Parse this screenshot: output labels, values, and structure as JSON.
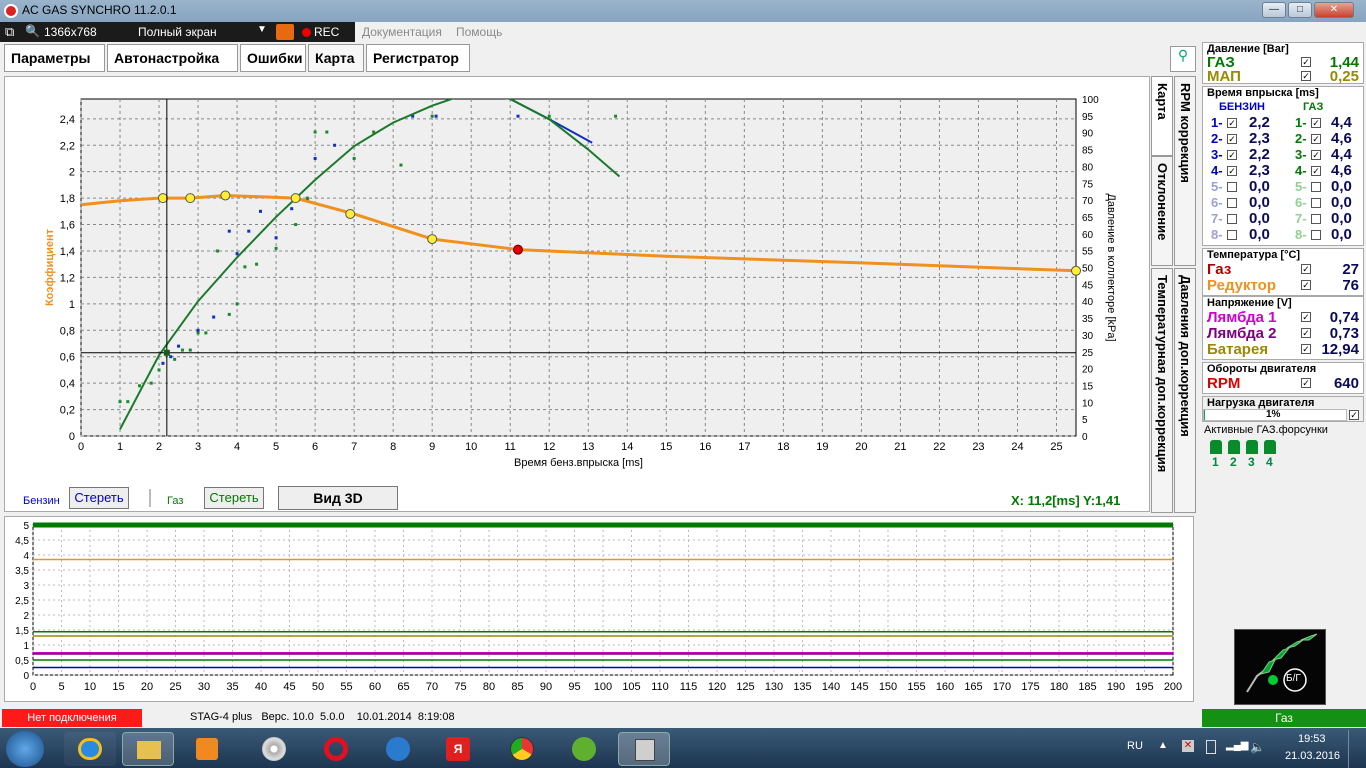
{
  "window": {
    "title": "AC GAS SYNCHRO  11.2.0.1",
    "btn_min": "—",
    "btn_max": "□",
    "btn_close": "✕"
  },
  "toolbar": {
    "resolution": "1366x768",
    "mode": "Полный экран",
    "rec": "REC"
  },
  "menu": {
    "documentation": "Документация",
    "help": "Помощь"
  },
  "tabs": [
    "Параметры",
    "Автонастройка",
    "Ошибки",
    "Карта",
    "Регистратор"
  ],
  "chart": {
    "ylabel_left": "Коэффициент",
    "ylabel_right": "Давление в коллекторе [kPa]",
    "xlabel": "Время бенз.впрыска [ms]"
  },
  "side_tabs": [
    "Карта",
    "RPM коррекция",
    "Отклонение",
    "Давления доп.коррекция",
    "Температурная доп.коррекция"
  ],
  "controls": {
    "benzin_label": "Бензин",
    "gas_label": "Газ",
    "clear1": "Стереть",
    "clear2": "Стереть",
    "view3d": "Вид 3D",
    "xy": "X: 11,2[ms] Y:1,41"
  },
  "pressure": {
    "header": "Давление [Bar]",
    "gas_label": "ГАЗ",
    "gas_value": "1,44",
    "map_label": "МАП",
    "map_value": "0,25"
  },
  "injection": {
    "header": "Время впрыска [ms]",
    "benzin": "БЕНЗИН",
    "gas": "ГАЗ",
    "rows": [
      {
        "n": "1-",
        "b": "2,2",
        "gn": "1-",
        "g": "4,4",
        "on": true
      },
      {
        "n": "2-",
        "b": "2,3",
        "gn": "2-",
        "g": "4,6",
        "on": true
      },
      {
        "n": "3-",
        "b": "2,2",
        "gn": "3-",
        "g": "4,4",
        "on": true
      },
      {
        "n": "4-",
        "b": "2,3",
        "gn": "4-",
        "g": "4,6",
        "on": true
      },
      {
        "n": "5-",
        "b": "0,0",
        "gn": "5-",
        "g": "0,0",
        "on": false
      },
      {
        "n": "6-",
        "b": "0,0",
        "gn": "6-",
        "g": "0,0",
        "on": false
      },
      {
        "n": "7-",
        "b": "0,0",
        "gn": "7-",
        "g": "0,0",
        "on": false
      },
      {
        "n": "8-",
        "b": "0,0",
        "gn": "8-",
        "g": "0,0",
        "on": false
      }
    ]
  },
  "temperature": {
    "header": "Температура [°C]",
    "gas_label": "Газ",
    "gas_value": "27",
    "red_label": "Редуктор",
    "red_value": "76"
  },
  "voltage": {
    "header": "Напряжение [V]",
    "l1_label": "Лямбда 1",
    "l1_value": "0,74",
    "l2_label": "Лямбда 2",
    "l2_value": "0,73",
    "bat_label": "Батарея",
    "bat_value": "12,94"
  },
  "rpm": {
    "header": "Обороты двигателя",
    "label": "RPM",
    "value": "640"
  },
  "load": {
    "header": "Нагрузка двигателя",
    "value": "1%"
  },
  "injectors": {
    "header": "Активные ГАЗ.форсунки",
    "labels": [
      "1",
      "2",
      "3",
      "4"
    ]
  },
  "logo": {
    "text": "Б/Г"
  },
  "status": {
    "connection": "Нет подключения",
    "device": "STAG-4 plus   Верс. 10.0  5.0.0    10.01.2014  8:19:08",
    "mode": "Газ"
  },
  "tray": {
    "lang": "RU",
    "time": "19:53",
    "date": "21.03.2016"
  },
  "colors": {
    "gas_green": "#007a00",
    "benzin_blue": "#0000c8",
    "map_olive": "#9a8a00",
    "orange": "#f0901e",
    "status_red": "#ff1a1a",
    "status_green": "#139113"
  },
  "chart_data": [
    {
      "type": "scatter",
      "xlabel": "Время бенз.впрыска [ms]",
      "ylabel": "Коэффициент",
      "y2label": "Давление в коллекторе [kPa]",
      "xlim": [
        0,
        25.5
      ],
      "ylim": [
        0,
        2.55
      ],
      "y2lim": [
        0,
        100
      ],
      "grid": true,
      "x_ticks": [
        0,
        1,
        2,
        3,
        4,
        5,
        6,
        7,
        8,
        9,
        10,
        11,
        12,
        13,
        14,
        15,
        16,
        17,
        18,
        19,
        20,
        21,
        22,
        23,
        24,
        25
      ],
      "y_ticks": [
        "0",
        "0,2",
        "0,4",
        "0,6",
        "0,8",
        "1",
        "1,2",
        "1,4",
        "1,6",
        "1,8",
        "2",
        "2,2",
        "2,4"
      ],
      "y2_ticks": [
        0,
        5,
        10,
        15,
        20,
        25,
        30,
        35,
        40,
        45,
        50,
        55,
        60,
        65,
        70,
        75,
        80,
        85,
        90,
        95,
        100
      ],
      "coefficient_curve": {
        "x": [
          0,
          1,
          2,
          2.8,
          3.7,
          5.5,
          7,
          9,
          11.2,
          15,
          20,
          25.5
        ],
        "y": [
          1.75,
          1.78,
          1.8,
          1.8,
          1.82,
          1.8,
          1.68,
          1.49,
          1.41,
          1.36,
          1.31,
          1.25
        ]
      },
      "coefficient_points": {
        "x": [
          2.1,
          2.8,
          3.7,
          5.5,
          6.9,
          9.0,
          25.5
        ],
        "y": [
          1.8,
          1.8,
          1.82,
          1.8,
          1.68,
          1.49,
          1.25
        ]
      },
      "current_point": {
        "x": 11.2,
        "y": 1.41
      },
      "gas_curve_kpa": {
        "x": [
          1,
          2,
          3,
          4,
          5,
          6,
          7,
          8,
          9,
          10,
          11,
          12,
          13,
          13.8
        ],
        "y": [
          2,
          24,
          40,
          53,
          65,
          76,
          86,
          93,
          98,
          102,
          100,
          94,
          85,
          77
        ]
      },
      "benzin_curve_kpa": {
        "x": [
          11,
          12,
          13.1
        ],
        "y": [
          100,
          94,
          87
        ]
      },
      "gas_points": {
        "x": [
          1,
          1.2,
          1.5,
          1.8,
          2,
          2.4,
          2.6,
          2.8,
          3,
          3.2,
          3.5,
          3.8,
          4,
          4.2,
          4.5,
          5,
          5.5,
          5.8,
          6,
          6.3,
          7,
          7.5,
          8.2,
          9,
          12,
          13.7
        ],
        "y": [
          0.26,
          0.26,
          0.38,
          0.4,
          0.5,
          0.58,
          0.65,
          0.65,
          0.78,
          0.78,
          1.4,
          0.92,
          1.0,
          1.28,
          1.3,
          1.42,
          1.6,
          1.8,
          2.3,
          2.3,
          2.1,
          2.3,
          2.05,
          2.42,
          2.42,
          2.42
        ]
      },
      "benzin_points": {
        "x": [
          2.1,
          2.3,
          2.5,
          3.0,
          3.4,
          3.8,
          4.0,
          4.3,
          4.6,
          5.0,
          5.4,
          5.8,
          6.0,
          6.5,
          8.5,
          9.1,
          11.2
        ],
        "y": [
          0.55,
          0.6,
          0.68,
          0.8,
          0.9,
          1.55,
          1.38,
          1.55,
          1.7,
          1.5,
          1.72,
          1.78,
          2.1,
          2.2,
          2.42,
          2.42,
          2.42
        ]
      },
      "cursor": {
        "x": 2.2,
        "y": 0.63
      }
    },
    {
      "type": "line",
      "xlim": [
        0,
        200
      ],
      "ylim": [
        0,
        5
      ],
      "x_ticks": [
        0,
        5,
        10,
        15,
        20,
        25,
        30,
        35,
        40,
        45,
        50,
        55,
        60,
        65,
        70,
        75,
        80,
        85,
        90,
        95,
        100,
        105,
        110,
        115,
        120,
        125,
        130,
        135,
        140,
        145,
        150,
        155,
        160,
        165,
        170,
        175,
        180,
        185,
        190,
        195,
        200
      ],
      "y_ticks": [
        "0",
        "0,5",
        "1",
        "1,5",
        "2",
        "2,5",
        "3",
        "3,5",
        "4",
        "4,5",
        "5"
      ],
      "series": [
        {
          "color": "#f0901e",
          "value": 3.85
        },
        {
          "color": "#007a00",
          "value": 1.44
        },
        {
          "color": "#9a8a00",
          "value": 1.3
        },
        {
          "color": "#d000d0",
          "value": 0.74
        },
        {
          "color": "#800080",
          "value": 0.7
        },
        {
          "color": "#007a00",
          "value": 0.5
        },
        {
          "color": "#0000c8",
          "value": 0.25
        },
        {
          "color": "#007a00",
          "value": 5.0
        }
      ]
    }
  ]
}
